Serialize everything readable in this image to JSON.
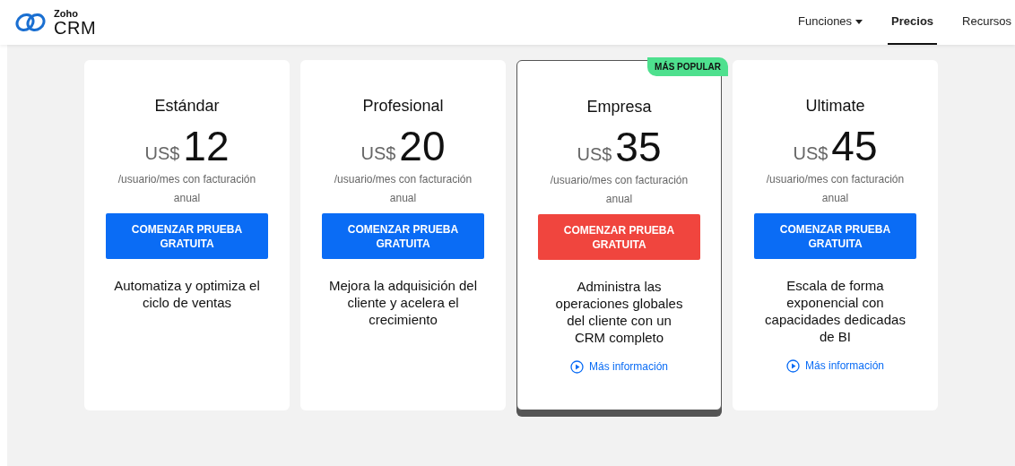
{
  "logo": {
    "brand": "Zoho",
    "product": "CRM"
  },
  "nav": [
    {
      "label": "Funciones",
      "kind": "dropdown",
      "selected": false
    },
    {
      "label": "Precios",
      "kind": "link",
      "selected": true
    },
    {
      "label": "Recursos",
      "kind": "link",
      "selected": false
    }
  ],
  "plans": [
    {
      "name": "Estándar",
      "currency": "US$",
      "amount": "12",
      "period": "/usuario/mes con facturación anual",
      "cta": "COMENZAR PRUEBA GRATUITA",
      "description": "Automatiza y optimiza el ciclo de ventas",
      "selected": false
    },
    {
      "name": "Profesional",
      "currency": "US$",
      "amount": "20",
      "period": "/usuario/mes con facturación anual",
      "cta": "COMENZAR PRUEBA GRATUITA",
      "description": "Mejora la adquisición del cliente y acelera el crecimiento",
      "selected": false
    },
    {
      "name": "Empresa",
      "currency": "US$",
      "amount": "35",
      "period": "/usuario/mes con facturación anual",
      "cta": "COMENZAR PRUEBA GRATUITA",
      "description": "Administra las operaciones globales del cliente con un CRM completo",
      "more": "Más información",
      "badge": "MÁS POPULAR",
      "selected": true
    },
    {
      "name": "Ultimate",
      "currency": "US$",
      "amount": "45",
      "period": "/usuario/mes con facturación anual",
      "cta": "COMENZAR PRUEBA GRATUITA",
      "description": "Escala de forma exponencial con capacidades dedicadas de BI",
      "more": "Más información",
      "selected": false
    }
  ]
}
